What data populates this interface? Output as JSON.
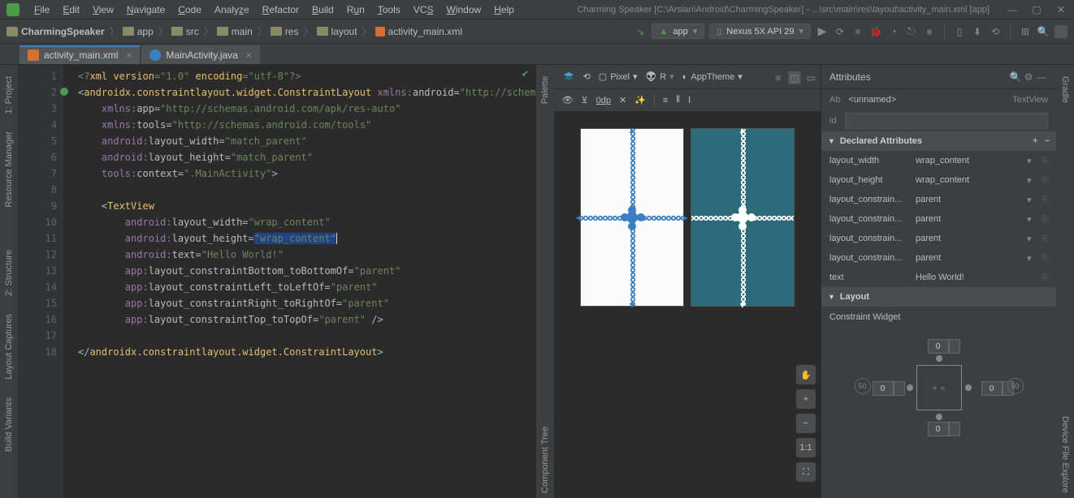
{
  "menubar": {
    "items": [
      "File",
      "Edit",
      "View",
      "Navigate",
      "Code",
      "Analyze",
      "Refactor",
      "Build",
      "Run",
      "Tools",
      "VCS",
      "Window",
      "Help"
    ],
    "title": "Charming Speaker [C:\\Arslan\\Android\\CharmingSpeaker] - ...\\src\\main\\res\\layout\\activity_main.xml [app]"
  },
  "breadcrumbs": [
    "CharmingSpeaker",
    "app",
    "src",
    "main",
    "res",
    "layout",
    "activity_main.xml"
  ],
  "toolbar": {
    "config": "app",
    "device_label": "Nexus 5X API 29"
  },
  "tabs": [
    {
      "name": "activity_main.xml",
      "icon": "xml",
      "active": true
    },
    {
      "name": "MainActivity.java",
      "icon": "java",
      "active": false
    }
  ],
  "left_tools": [
    "1: Project",
    "Resource Manager",
    "2: Structure",
    "Layout Captures",
    "Build Variants"
  ],
  "right_tools": [
    "Gradle",
    "Device File Explore"
  ],
  "editor": {
    "lines": 18
  },
  "designer": {
    "pixel_label": "Pixel",
    "r_label": "R",
    "theme_label": "AppTheme",
    "default_dp": "0dp",
    "component_tree": "Component Tree",
    "palette": "Palette",
    "ratio": "1:1"
  },
  "attrs": {
    "title": "Attributes",
    "unnamed": "<unnamed>",
    "type": "TextView",
    "id_label": "id",
    "ab": "Ab",
    "declared_header": "Declared Attributes",
    "layout_header": "Layout",
    "cw_label": "Constraint Widget",
    "rows": [
      {
        "name": "layout_width",
        "value": "wrap_content",
        "dd": true
      },
      {
        "name": "layout_height",
        "value": "wrap_content",
        "dd": true
      },
      {
        "name": "layout_constrain...",
        "value": "parent",
        "dd": true
      },
      {
        "name": "layout_constrain...",
        "value": "parent",
        "dd": true
      },
      {
        "name": "layout_constrain...",
        "value": "parent",
        "dd": true
      },
      {
        "name": "layout_constrain...",
        "value": "parent",
        "dd": true
      },
      {
        "name": "text",
        "value": "Hello World!",
        "dd": false
      }
    ],
    "cw_vals": {
      "top": "0",
      "left": "0",
      "right": "0",
      "bottom": "0",
      "bias_h": "50",
      "bias_v": "50"
    }
  }
}
